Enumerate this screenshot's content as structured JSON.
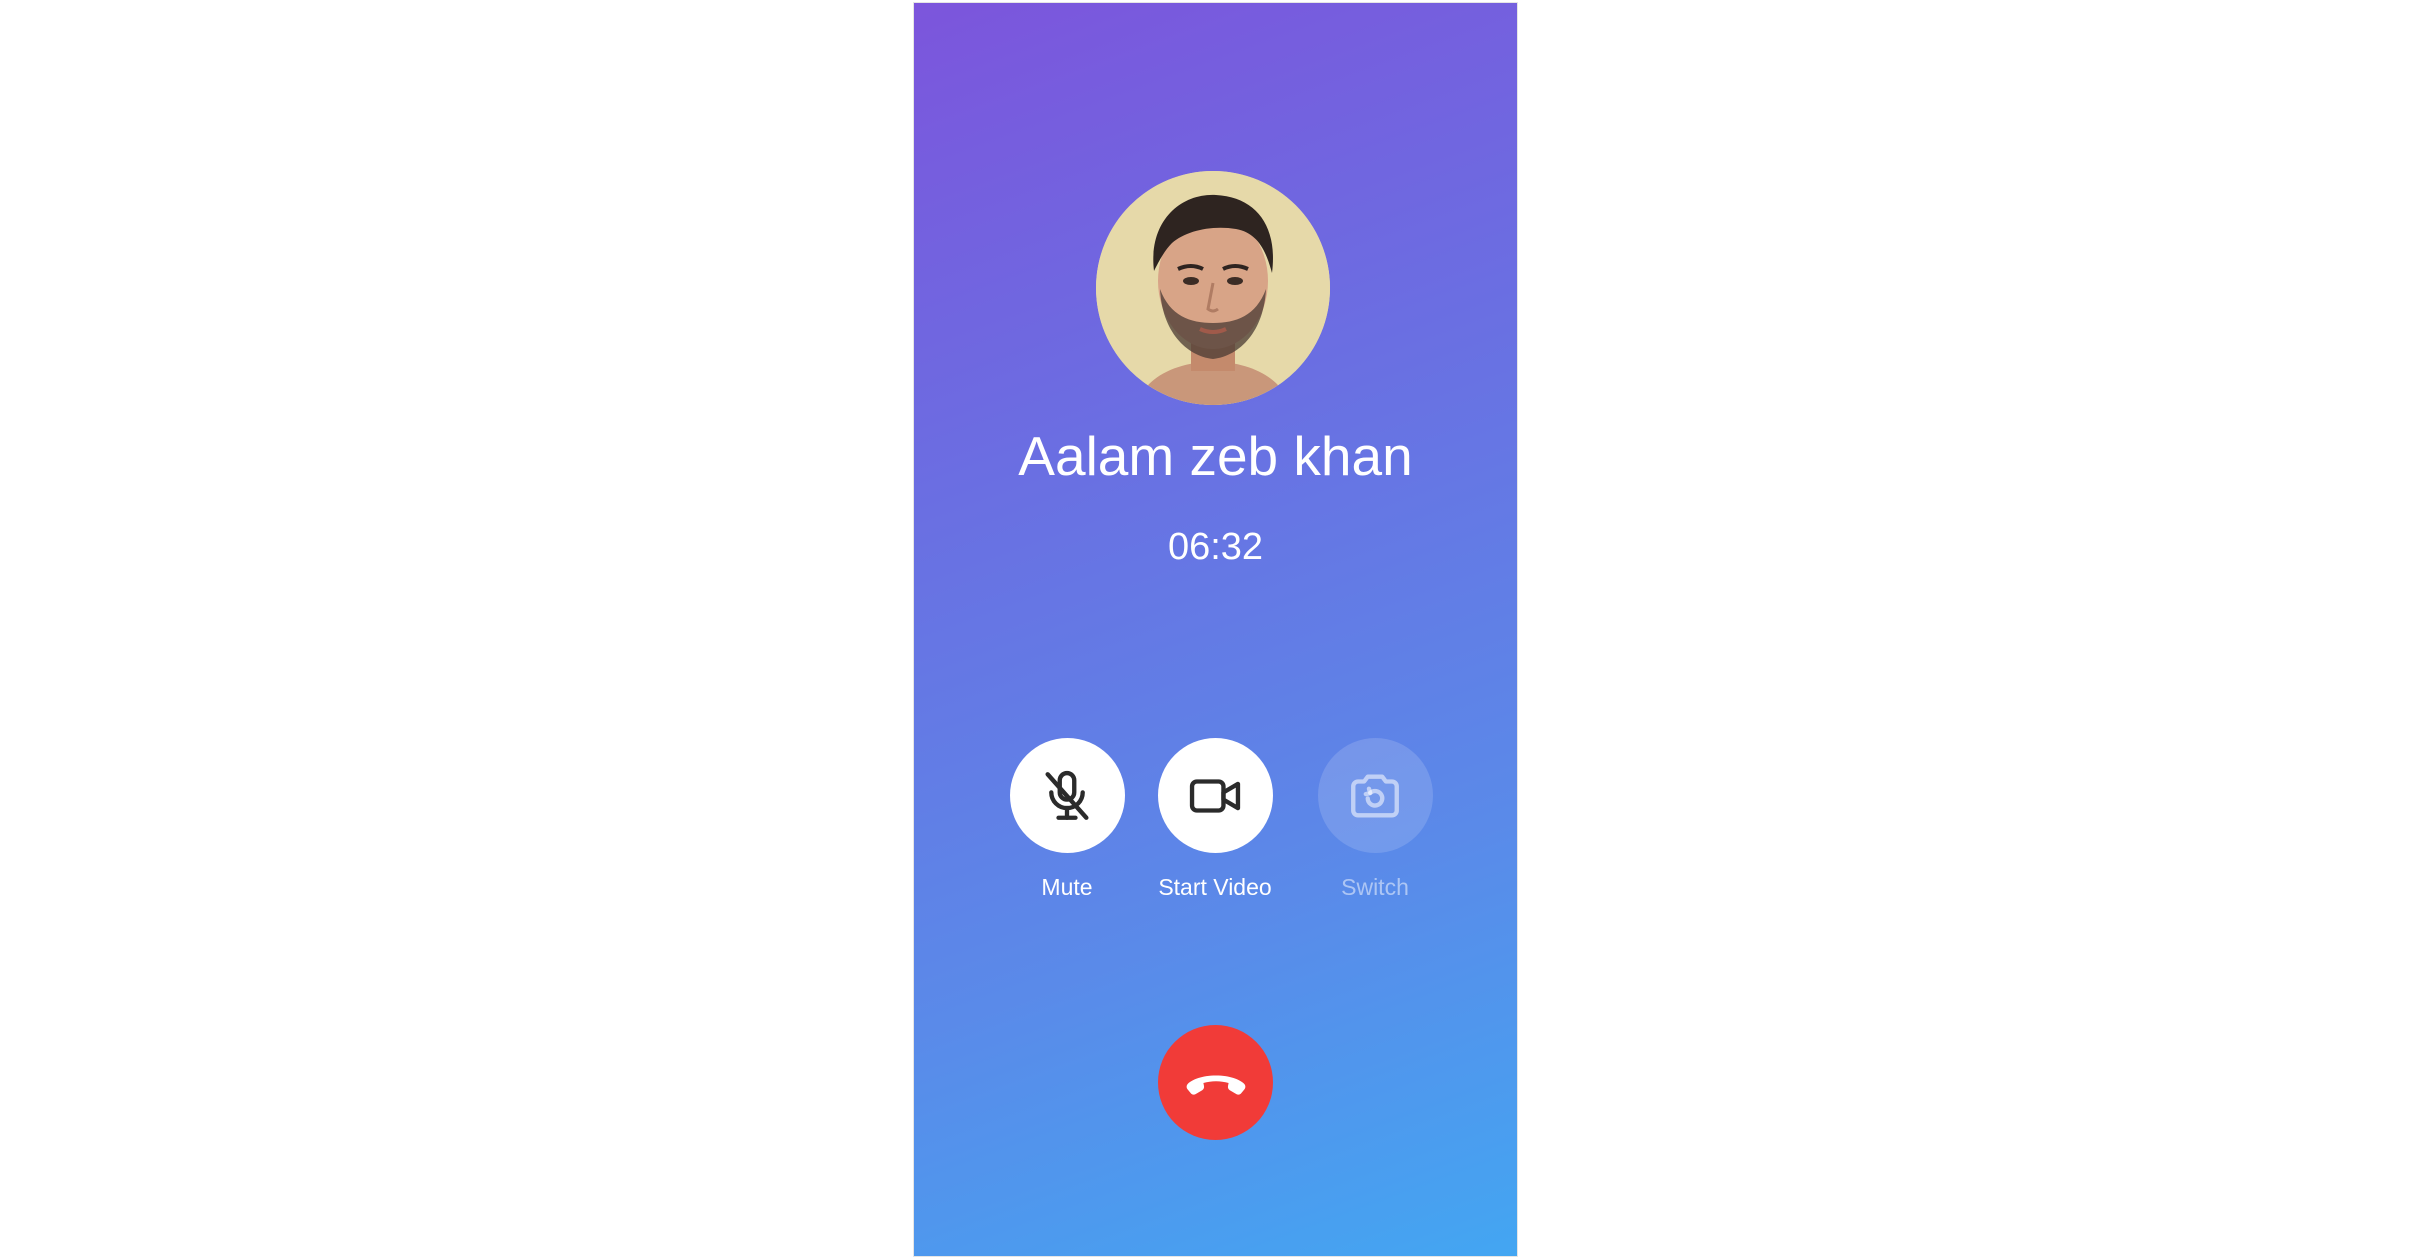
{
  "caller": {
    "name": "Aalam zeb khan",
    "timer": "06:32",
    "avatar_icon": "person-avatar"
  },
  "controls": [
    {
      "label": "Mute",
      "icon": "mic-off-icon",
      "enabled": true
    },
    {
      "label": "Start Video",
      "icon": "video-camera-icon",
      "enabled": true
    },
    {
      "label": "Switch",
      "icon": "switch-camera-icon",
      "enabled": false
    }
  ],
  "end_call": {
    "icon": "hang-up-icon",
    "color": "#f13b38"
  },
  "colors": {
    "gradient_top": "#7c55dc",
    "gradient_bottom": "#43a6f2",
    "text": "#ffffff"
  }
}
